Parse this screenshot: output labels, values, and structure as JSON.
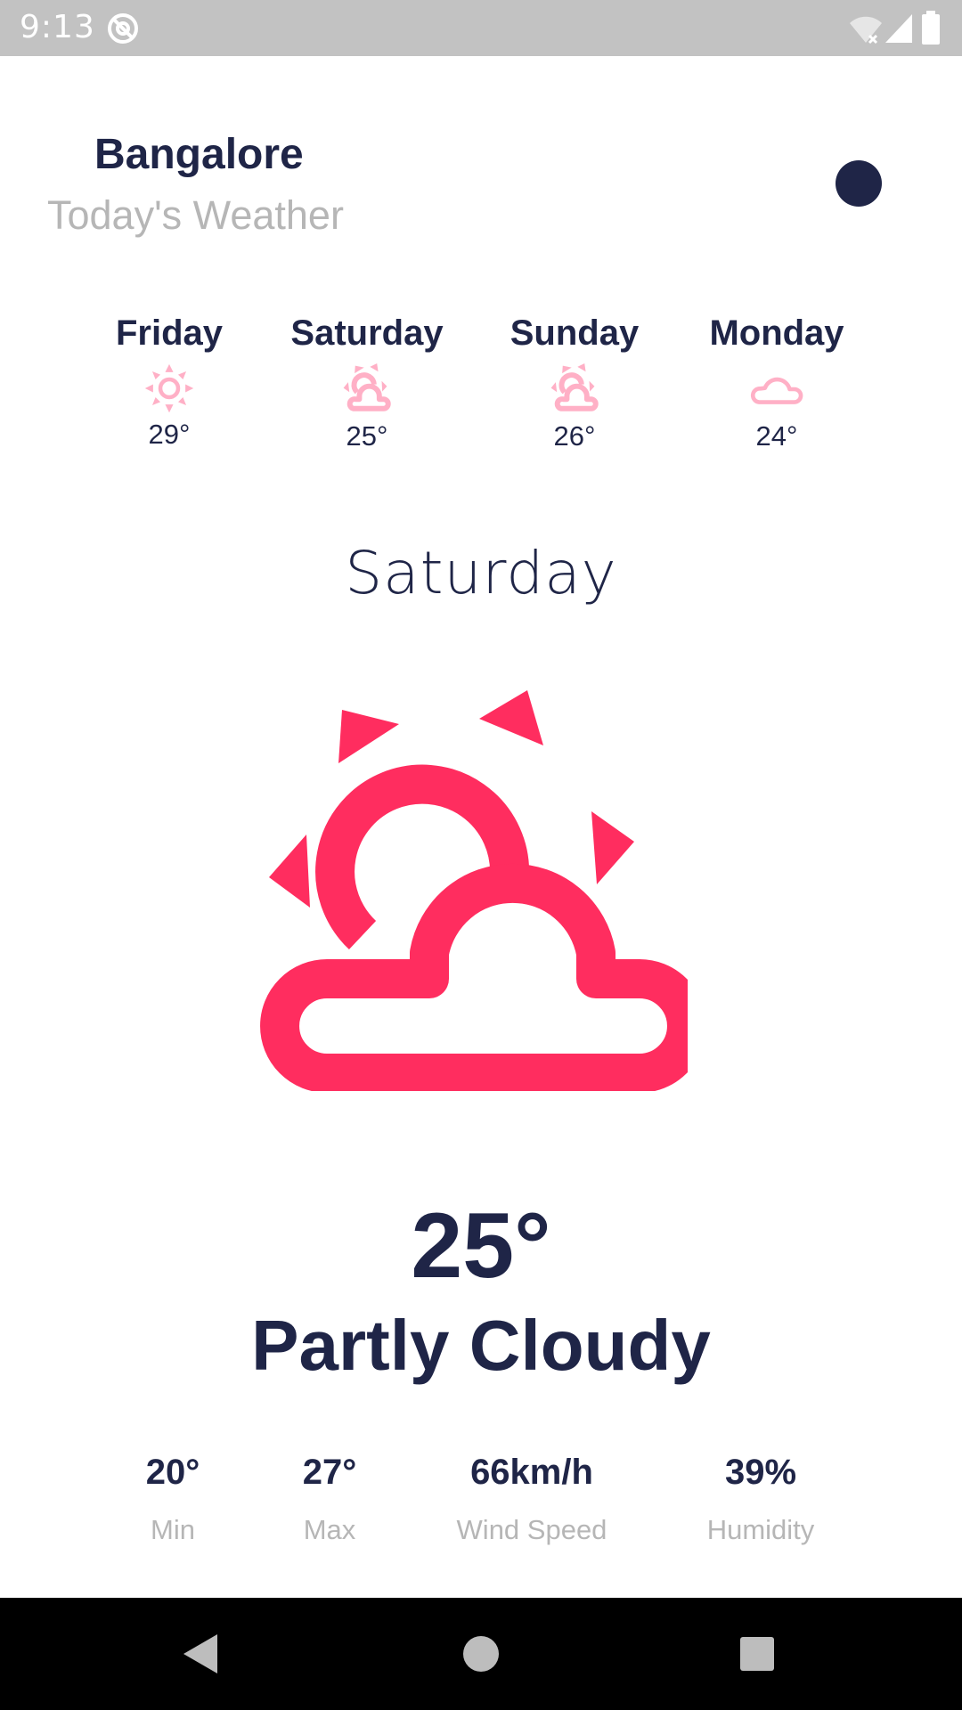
{
  "status_bar": {
    "time": "9:13",
    "icons": [
      "sync-at-icon",
      "wifi-off-icon",
      "signal-icon",
      "battery-icon"
    ]
  },
  "header": {
    "city": "Bangalore",
    "subtitle": "Today's Weather",
    "theme_toggle_color": "#1f2547"
  },
  "forecast": [
    {
      "day": "Friday",
      "temp": "29°",
      "icon": "sun-icon"
    },
    {
      "day": "Saturday",
      "temp": "25°",
      "icon": "partly-cloudy-icon"
    },
    {
      "day": "Sunday",
      "temp": "26°",
      "icon": "partly-cloudy-icon"
    },
    {
      "day": "Monday",
      "temp": "24°",
      "icon": "cloud-icon"
    }
  ],
  "current": {
    "day": "Saturday",
    "icon": "partly-cloudy-icon",
    "temp": "25°",
    "condition": "Partly Cloudy"
  },
  "stats": [
    {
      "value": "20°",
      "label": "Min"
    },
    {
      "value": "27°",
      "label": "Max"
    },
    {
      "value": "66km/h",
      "label": "Wind Speed"
    },
    {
      "value": "39%",
      "label": "Humidity"
    }
  ],
  "nav_bar": {
    "buttons": [
      "back-icon",
      "home-icon",
      "recents-icon"
    ]
  },
  "colors": {
    "primary": "#1f2547",
    "accent": "#ff2d5f",
    "accent_light": "#ffb0c6",
    "muted_text": "#b6b6b6"
  }
}
